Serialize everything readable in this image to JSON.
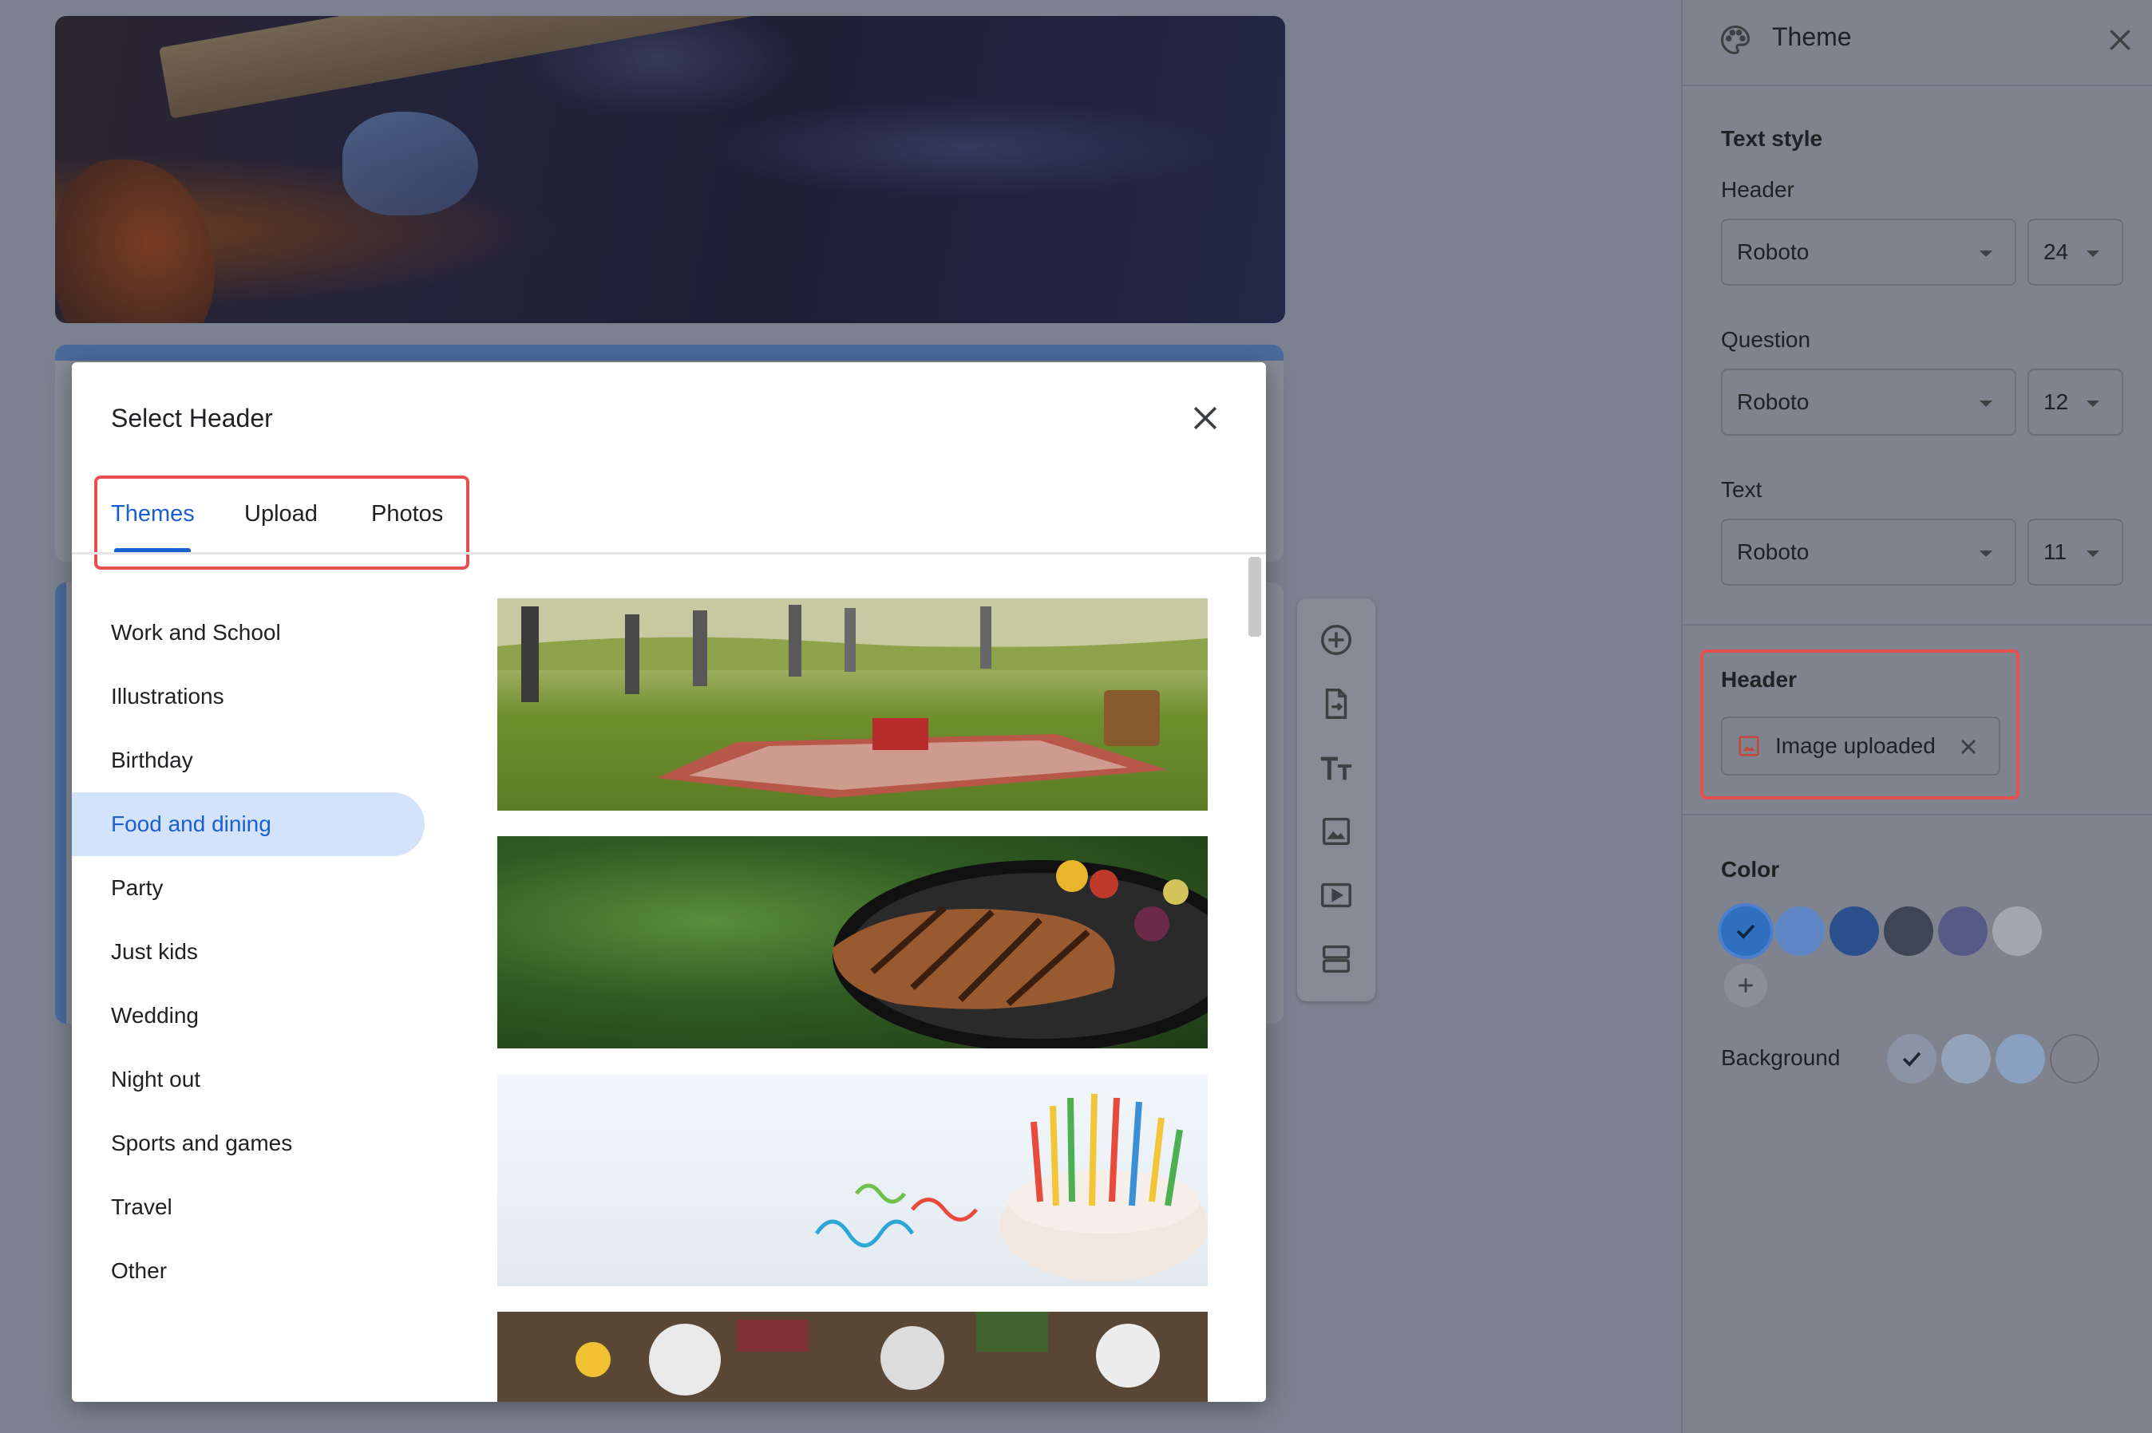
{
  "theme_panel": {
    "title": "Theme",
    "text_style": {
      "section_label": "Text style",
      "header": {
        "label": "Header",
        "font": "Roboto",
        "size": "24"
      },
      "question": {
        "label": "Question",
        "font": "Roboto",
        "size": "12"
      },
      "text": {
        "label": "Text",
        "font": "Roboto",
        "size": "11"
      }
    },
    "header_section": {
      "label": "Header",
      "chip_label": "Image uploaded"
    },
    "color_section": {
      "label": "Color",
      "swatches": [
        "#2f6fc0",
        "#5e86c6",
        "#2c4f8e",
        "#3e4656",
        "#555b86",
        "#a3a6b0"
      ],
      "selected_index": 0
    },
    "background_section": {
      "label": "Background",
      "swatches": [
        "#8b94a6",
        "#93a3b9",
        "#8aa0c0",
        "#7e838e"
      ],
      "selected_index": 0
    }
  },
  "modal": {
    "title": "Select Header",
    "tabs": [
      {
        "label": "Themes",
        "active": true
      },
      {
        "label": "Upload",
        "active": false
      },
      {
        "label": "Photos",
        "active": false
      }
    ],
    "categories": [
      "Work and School",
      "Illustrations",
      "Birthday",
      "Food and dining",
      "Party",
      "Just kids",
      "Wedding",
      "Night out",
      "Sports and games",
      "Travel",
      "Other"
    ],
    "selected_category": "Food and dining"
  },
  "colors": {
    "accent": "#1a5fd1",
    "selected_bg": "#d3e3fb",
    "highlight_outline": "#ea4f4f"
  }
}
